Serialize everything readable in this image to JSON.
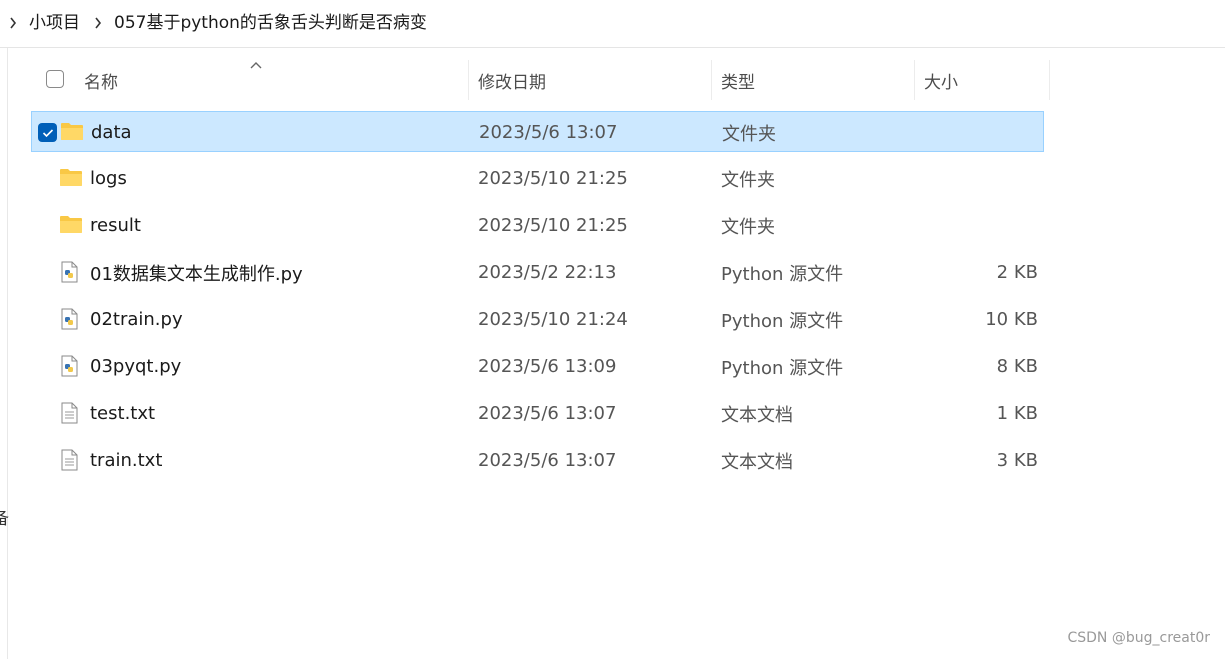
{
  "breadcrumb": {
    "items": [
      "小项目",
      "057基于python的舌象舌头判断是否病变"
    ]
  },
  "columns": {
    "name": "名称",
    "date": "修改日期",
    "type": "类型",
    "size": "大小"
  },
  "left_edge_glyph": "备",
  "files": [
    {
      "name": "data",
      "date": "2023/5/6 13:07",
      "type": "文件夹",
      "size": "",
      "icon": "folder-icon",
      "selected": true
    },
    {
      "name": "logs",
      "date": "2023/5/10 21:25",
      "type": "文件夹",
      "size": "",
      "icon": "folder-icon",
      "selected": false
    },
    {
      "name": "result",
      "date": "2023/5/10 21:25",
      "type": "文件夹",
      "size": "",
      "icon": "folder-icon",
      "selected": false
    },
    {
      "name": "01数据集文本生成制作.py",
      "date": "2023/5/2 22:13",
      "type": "Python 源文件",
      "size": "2 KB",
      "icon": "python-file-icon",
      "selected": false
    },
    {
      "name": "02train.py",
      "date": "2023/5/10 21:24",
      "type": "Python 源文件",
      "size": "10 KB",
      "icon": "python-file-icon",
      "selected": false
    },
    {
      "name": "03pyqt.py",
      "date": "2023/5/6 13:09",
      "type": "Python 源文件",
      "size": "8 KB",
      "icon": "python-file-icon",
      "selected": false
    },
    {
      "name": "test.txt",
      "date": "2023/5/6 13:07",
      "type": "文本文档",
      "size": "1 KB",
      "icon": "text-file-icon",
      "selected": false
    },
    {
      "name": "train.txt",
      "date": "2023/5/6 13:07",
      "type": "文本文档",
      "size": "3 KB",
      "icon": "text-file-icon",
      "selected": false
    }
  ],
  "watermark": "CSDN @bug_creat0r",
  "colors": {
    "selection_bg": "#cce8ff",
    "selection_border": "#99d1ff",
    "checkbox_accent": "#005fb8",
    "folder": "#f9c845"
  }
}
